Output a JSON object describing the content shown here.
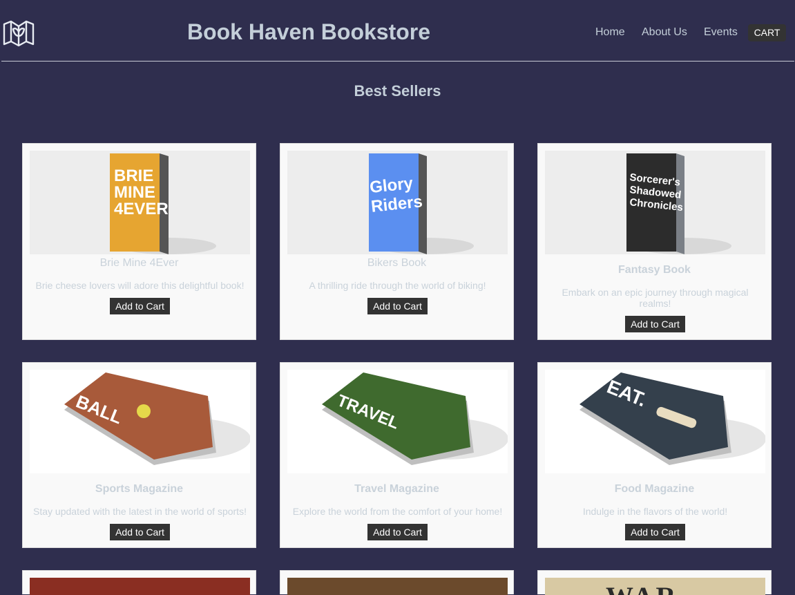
{
  "header": {
    "title": "Book Haven Bookstore",
    "logo_icon": "open-book-icon",
    "nav": [
      {
        "label": "Home"
      },
      {
        "label": "About Us"
      },
      {
        "label": "Events"
      }
    ],
    "cart_label": "CART"
  },
  "section": {
    "title": "Best Sellers"
  },
  "products": [
    {
      "title": "Brie Mine 4Ever",
      "description": "Brie cheese lovers will adore this delightful book!",
      "button": "Add to Cart",
      "cover_text": "BRIE MINE 4EVER",
      "cover_color": "#e6a531"
    },
    {
      "title": "Bikers Book",
      "description": "A thrilling ride through the world of biking!",
      "button": "Add to Cart",
      "cover_text": "Glory Riders",
      "cover_color": "#5b8ff0"
    },
    {
      "title": "Fantasy Book",
      "description": "Embark on an epic journey through magical realms!",
      "button": "Add to Cart",
      "cover_text": "Sorcerer's Shadowed Chronicles",
      "cover_color": "#2c2c2c"
    },
    {
      "title": "Sports Magazine",
      "description": "Stay updated with the latest in the world of sports!",
      "button": "Add to Cart",
      "cover_text": "BALL",
      "cover_color": "#a85a3a"
    },
    {
      "title": "Travel Magazine",
      "description": "Explore the world from the comfort of your home!",
      "button": "Add to Cart",
      "cover_text": "TRAVEL",
      "cover_color": "#3f6a2e"
    },
    {
      "title": "Food Magazine",
      "description": "Indulge in the flavors of the world!",
      "button": "Add to Cart",
      "cover_text": "EAT.",
      "cover_color": "#34404c"
    }
  ],
  "partial_cards": [
    {
      "cover_text": "",
      "cover_color": "#8a2e22"
    },
    {
      "cover_text": "",
      "cover_color": "#6b4a2c"
    },
    {
      "cover_text": "WAR",
      "cover_color": "#d8c9a3"
    }
  ]
}
